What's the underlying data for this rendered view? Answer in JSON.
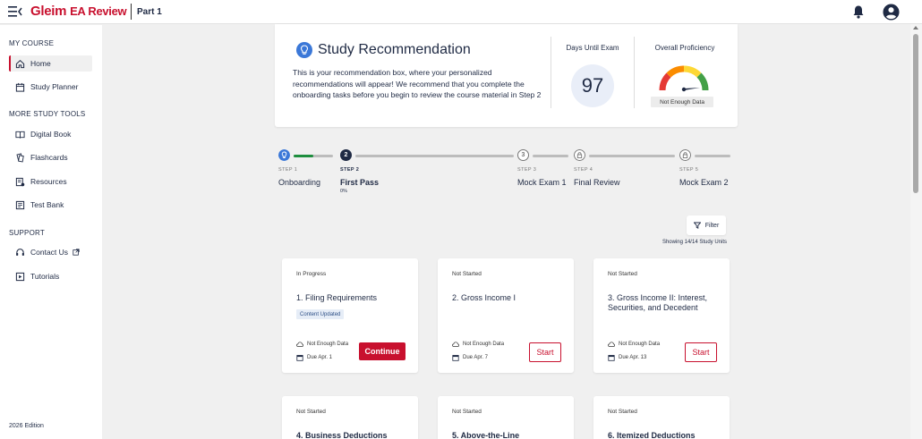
{
  "header": {
    "logo_brand": "Gleim",
    "logo_product": "EA Review",
    "part": "Part 1"
  },
  "sidebar": {
    "my_course_heading": "MY COURSE",
    "my_course_items": [
      {
        "label": "Home",
        "icon": "home-icon",
        "active": true
      },
      {
        "label": "Study Planner",
        "icon": "calendar-icon",
        "active": false
      }
    ],
    "more_tools_heading": "MORE STUDY TOOLS",
    "more_tools_items": [
      {
        "label": "Digital Book",
        "icon": "book-icon"
      },
      {
        "label": "Flashcards",
        "icon": "flashcards-icon"
      },
      {
        "label": "Resources",
        "icon": "resources-icon"
      },
      {
        "label": "Test Bank",
        "icon": "test-bank-icon"
      }
    ],
    "support_heading": "SUPPORT",
    "support_items": [
      {
        "label": "Contact Us",
        "icon": "headset-icon"
      },
      {
        "label": "Tutorials",
        "icon": "tutorials-icon"
      }
    ],
    "edition": "2026 Edition"
  },
  "recommendation": {
    "title": "Study Recommendation",
    "body": "This is your recommendation box, where your personalized recommendations will appear! We recommend that you complete the onboarding tasks before you begin to review the course material in Step 2",
    "days_label": "Days Until Exam",
    "days_value": "97",
    "proficiency_label": "Overall Proficiency",
    "proficiency_badge": "Not Enough Data"
  },
  "steps": [
    {
      "num": "STEP 1",
      "name": "Onboarding",
      "state": "current-onboarding"
    },
    {
      "num": "STEP 2",
      "name": "First Pass",
      "pct": "0%",
      "badge": "2",
      "state": "active"
    },
    {
      "num": "STEP 3",
      "name": "Mock Exam 1",
      "badge": "3",
      "state": "upcoming"
    },
    {
      "num": "STEP 4",
      "name": "Final Review",
      "state": "locked"
    },
    {
      "num": "STEP 5",
      "name": "Mock Exam 2",
      "state": "locked"
    }
  ],
  "onboarding_progress": 0.5,
  "filter": {
    "label": "Filter",
    "showing": "Showing 14/14 Study Units"
  },
  "units": [
    {
      "status": "In Progress",
      "title": "1. Filing Requirements",
      "tag": "Content Updated",
      "data_note": "Not Enough Data",
      "due": "Due Apr. 1",
      "action": "Continue"
    },
    {
      "status": "Not Started",
      "title": "2. Gross Income I",
      "data_note": "Not Enough Data",
      "due": "Due Apr. 7",
      "action": "Start"
    },
    {
      "status": "Not Started",
      "title": "3. Gross Income II: Interest, Securities, and Decedent",
      "data_note": "Not Enough Data",
      "due": "Due Apr. 13",
      "action": "Start"
    },
    {
      "status": "Not Started",
      "title": "4. Business Deductions"
    },
    {
      "status": "Not Started",
      "title": "5. Above-the-Line"
    },
    {
      "status": "Not Started",
      "title": "6. Itemized Deductions"
    }
  ],
  "colors": {
    "brand_red": "#c8102e",
    "navy": "#1f2a44",
    "step_blue": "#3b78d8",
    "progress_green": "#1e8e3e"
  }
}
